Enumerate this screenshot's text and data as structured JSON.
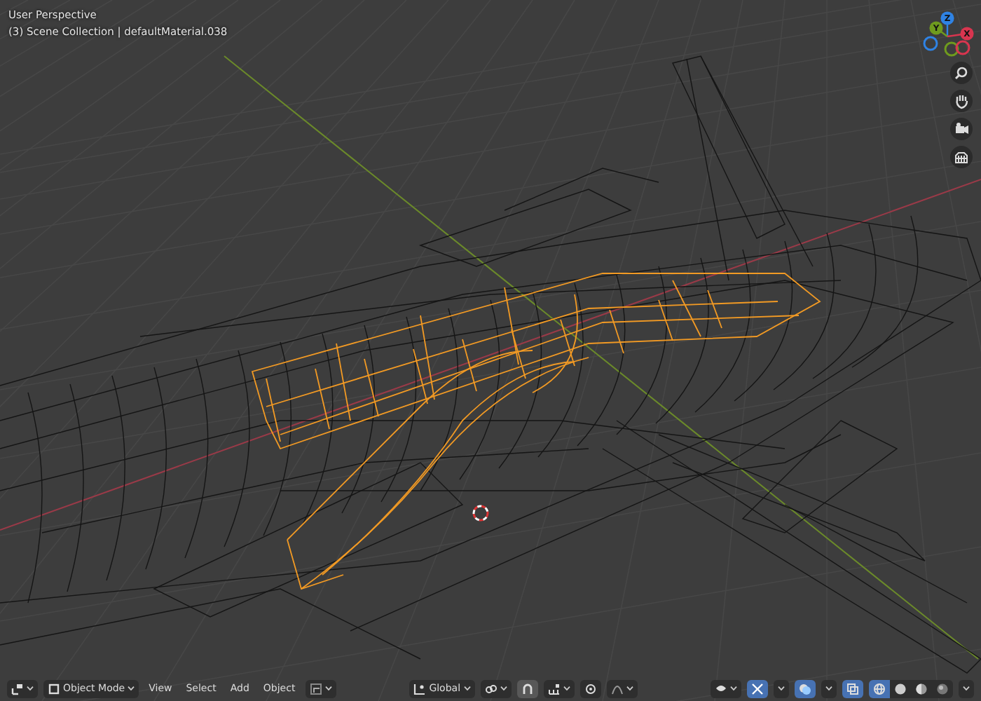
{
  "viewport": {
    "view_name": "User Perspective",
    "collection_info": "(3) Scene Collection | defaultMaterial.038"
  },
  "gizmo": {
    "axes": [
      {
        "label": "Z",
        "color": "#2f83e4"
      },
      {
        "label": "Y",
        "color": "#6f9b1e"
      },
      {
        "label": "X",
        "color": "#d8354f"
      }
    ]
  },
  "nav_buttons": [
    {
      "kind": "zoom"
    },
    {
      "kind": "pan"
    },
    {
      "kind": "camera"
    },
    {
      "kind": "ortho"
    }
  ],
  "header": {
    "mode": "Object Mode",
    "menus": [
      "View",
      "Select",
      "Add",
      "Object"
    ],
    "orientation": "Global",
    "toggles": [
      {
        "kind": "snap",
        "on": true
      },
      {
        "kind": "proportional",
        "on": false
      }
    ],
    "xray": {
      "on": true
    },
    "shading": [
      {
        "kind": "wireframe",
        "selected": true
      },
      {
        "kind": "solid",
        "selected": false
      },
      {
        "kind": "material",
        "selected": false
      },
      {
        "kind": "rendered",
        "selected": false
      }
    ]
  }
}
